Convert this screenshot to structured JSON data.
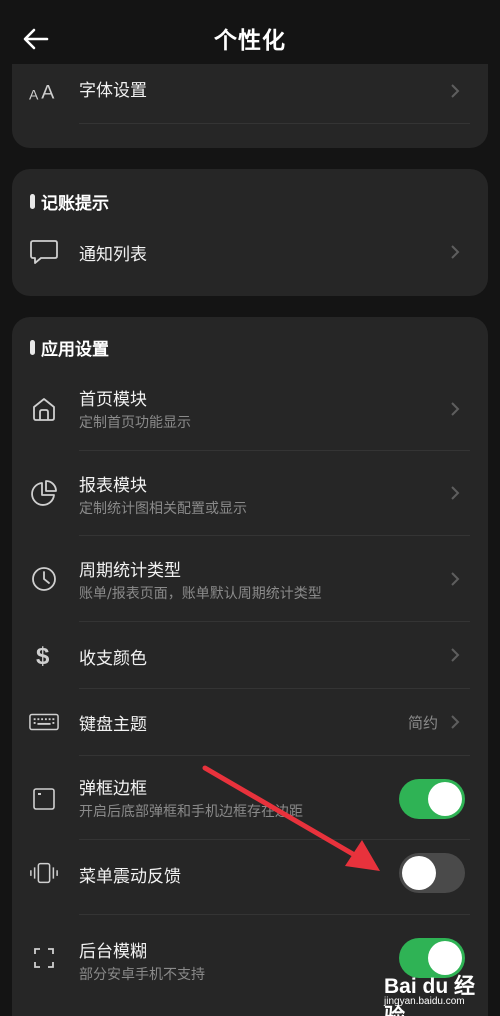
{
  "header": {
    "title": "个性化",
    "back_icon": "arrow-left-icon"
  },
  "font_card": {
    "font_settings": {
      "label": "字体设置",
      "icon": "font-size-icon"
    }
  },
  "notify_card": {
    "section": "记账提示",
    "items": [
      {
        "label": "通知列表",
        "icon": "chat-bubble-icon"
      }
    ]
  },
  "app_card": {
    "section": "应用设置",
    "items": [
      {
        "label": "首页模块",
        "subtitle": "定制首页功能显示",
        "icon": "home-icon"
      },
      {
        "label": "报表模块",
        "subtitle": "定制统计图相关配置或显示",
        "icon": "pie-chart-icon"
      },
      {
        "label": "周期统计类型",
        "subtitle": "账单/报表页面，账单默认周期统计类型",
        "icon": "clock-icon"
      },
      {
        "label": "收支颜色",
        "icon": "dollar-icon"
      },
      {
        "label": "键盘主题",
        "value": "简约",
        "icon": "keyboard-icon"
      },
      {
        "label": "弹框边框",
        "subtitle": "开启后底部弹框和手机边框存在边距",
        "icon": "window-frame-icon",
        "toggle": true
      },
      {
        "label": "菜单震动反馈",
        "icon": "vibration-icon",
        "toggle": false
      },
      {
        "label": "后台模糊",
        "subtitle": "部分安卓手机不支持",
        "icon": "expand-corners-icon",
        "toggle": true
      }
    ]
  },
  "watermark": {
    "logo": "Bai du 经验",
    "site": "jingyan.baidu.com"
  },
  "colors": {
    "background": "#141414",
    "card": "#262626",
    "toggle_on": "#2fb355",
    "toggle_off": "#4a4a4a",
    "annotation_arrow": "#e8323c"
  }
}
